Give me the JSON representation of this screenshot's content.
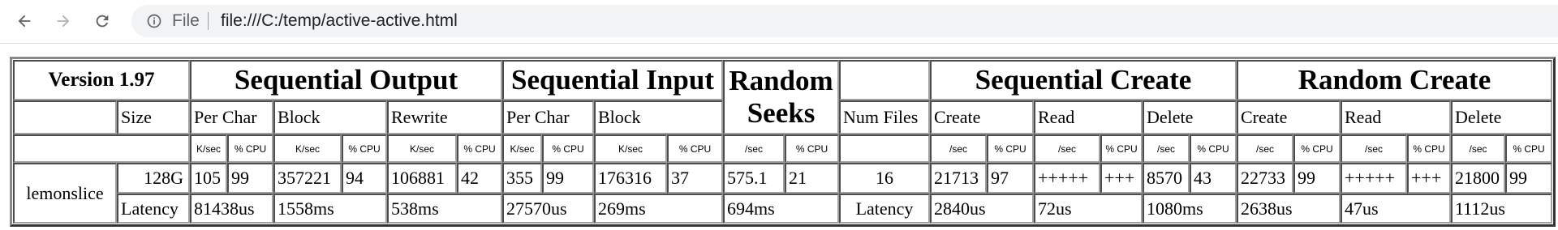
{
  "browser": {
    "site_label": "File",
    "url": "file:///C:/temp/active-active.html"
  },
  "table": {
    "version": "Version 1.97",
    "groups": {
      "seq_output": "Sequential Output",
      "seq_input": "Sequential Input",
      "random_seeks_line1": "Random",
      "random_seeks_line2": "Seeks",
      "seq_create": "Sequential Create",
      "random_create": "Random Create"
    },
    "sub": {
      "size": "Size",
      "per_char": "Per Char",
      "block": "Block",
      "rewrite": "Rewrite",
      "num_files": "Num Files",
      "create": "Create",
      "read": "Read",
      "delete": "Delete"
    },
    "units": {
      "ksec": "K/sec",
      "pcpu": "% CPU",
      "sec": "/sec"
    },
    "machine": "lemonslice",
    "size": "128G",
    "latency_label": "Latency",
    "num_files": "16",
    "values": {
      "so_perchar_k": "105",
      "so_perchar_cpu": "99",
      "so_block_k": "357221",
      "so_block_cpu": "94",
      "so_rewrite_k": "106881",
      "so_rewrite_cpu": "42",
      "si_perchar_k": "355",
      "si_perchar_cpu": "99",
      "si_block_k": "176316",
      "si_block_cpu": "37",
      "seeks_sec": "575.1",
      "seeks_cpu": "21",
      "sc_create": "21713",
      "sc_create_cpu": "97",
      "sc_read": "+++++",
      "sc_read_cpu": "+++",
      "sc_delete": "8570",
      "sc_delete_cpu": "43",
      "rc_create": "22733",
      "rc_create_cpu": "99",
      "rc_read": "+++++",
      "rc_read_cpu": "+++",
      "rc_delete": "21800",
      "rc_delete_cpu": "99"
    },
    "latency": {
      "so_perchar": "81438us",
      "so_block": "1558ms",
      "so_rewrite": "538ms",
      "si_perchar": "27570us",
      "si_block": "269ms",
      "seeks": "694ms",
      "sc_create": "2840us",
      "sc_read": "72us",
      "sc_delete": "1080ms",
      "rc_create": "2638us",
      "rc_read": "47us",
      "rc_delete": "1112us"
    }
  }
}
